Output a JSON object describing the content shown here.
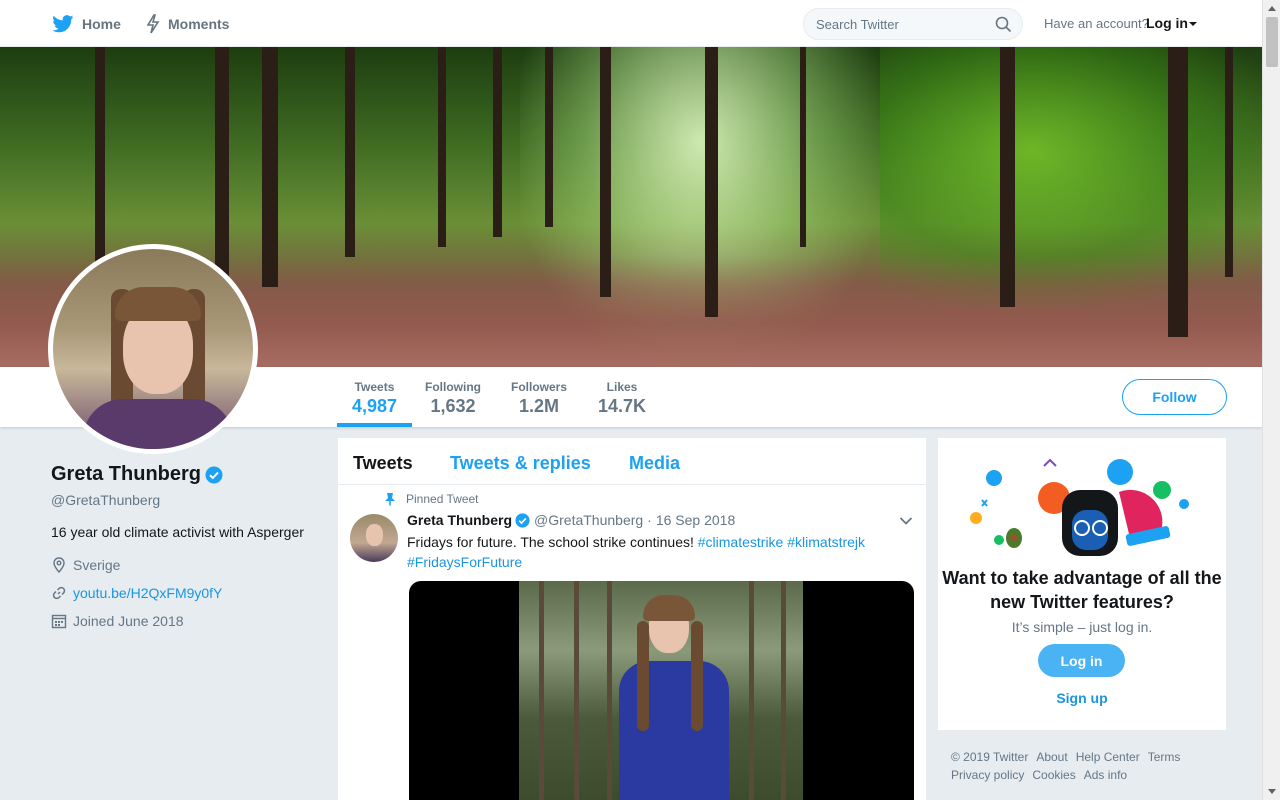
{
  "topnav": {
    "home_label": "Home",
    "moments_label": "Moments",
    "search_placeholder": "Search Twitter",
    "have_account": "Have an account?",
    "login_label": "Log in"
  },
  "profile_nav": {
    "stats": [
      {
        "label": "Tweets",
        "value": "4,987"
      },
      {
        "label": "Following",
        "value": "1,632"
      },
      {
        "label": "Followers",
        "value": "1.2M"
      },
      {
        "label": "Likes",
        "value": "14.7K"
      }
    ],
    "follow_label": "Follow"
  },
  "profile": {
    "name": "Greta Thunberg",
    "handle": "@GretaThunberg",
    "bio": "16 year old climate activist with Asperger",
    "location": "Sverige",
    "url": "youtu.be/H2QxFM9y0fY",
    "joined": "Joined June 2018"
  },
  "timeline": {
    "tabs": [
      "Tweets",
      "Tweets & replies",
      "Media"
    ],
    "tweet": {
      "pinned_label": "Pinned Tweet",
      "name": "Greta Thunberg",
      "handle": "@GretaThunberg",
      "dot": "·",
      "date": "16 Sep 2018",
      "text": "Fridays for future. The school strike continues! ",
      "hashtags": [
        "#climatestrike",
        "#klimatstrejk",
        "#FridaysForFuture"
      ]
    }
  },
  "promo": {
    "title": "Want to take advantage of all the new Twitter features?",
    "subtitle": "It’s simple – just log in.",
    "login_label": "Log in",
    "signup_label": "Sign up"
  },
  "footer": {
    "links": [
      "© 2019 Twitter",
      "About",
      "Help Center",
      "Terms",
      "Privacy policy",
      "Cookies",
      "Ads info"
    ]
  },
  "colors": {
    "accent": "#1da1f2",
    "link": "#1b95e0",
    "background": "#e6ecf0",
    "muted": "#657786"
  }
}
